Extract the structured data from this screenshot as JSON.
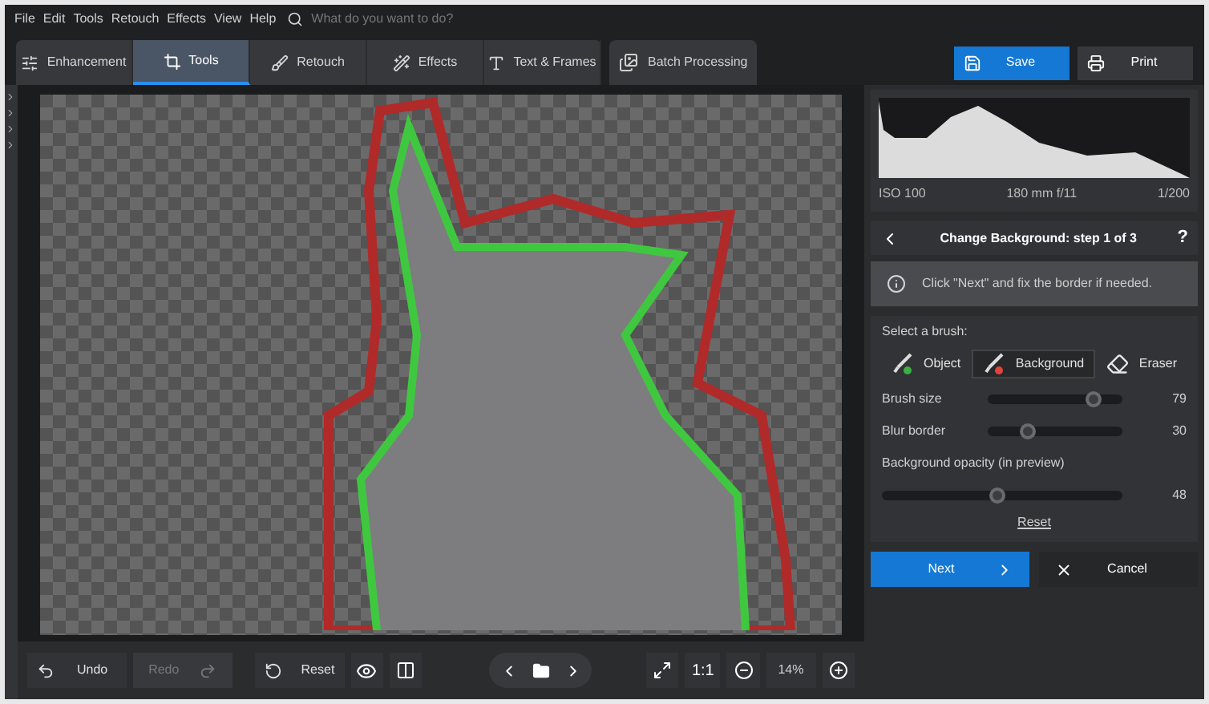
{
  "menu": [
    "File",
    "Edit",
    "Tools",
    "Retouch",
    "Effects",
    "View",
    "Help"
  ],
  "search": {
    "placeholder": "What do you want to do?"
  },
  "tabs": [
    {
      "label": "Enhancement",
      "kind": "sliders",
      "selected": false
    },
    {
      "label": "Tools",
      "kind": "crop",
      "selected": true
    },
    {
      "label": "Retouch",
      "kind": "brush",
      "selected": false
    },
    {
      "label": "Effects",
      "kind": "wand",
      "selected": false
    },
    {
      "label": "Text & Frames",
      "kind": "text",
      "selected": false
    }
  ],
  "batch_button": "Batch Processing",
  "save_button": "Save",
  "print_button": "Print",
  "histogram": {
    "iso": "ISO 100",
    "lens": "180 mm f/11",
    "shutter": "1/200"
  },
  "step": {
    "title": "Change Background: step 1 of 3",
    "help": "?"
  },
  "info": "Click \"Next\" and fix the border if needed.",
  "brush_label": "Select a brush:",
  "brushes": [
    {
      "label": "Object",
      "kind": "object",
      "selected": false
    },
    {
      "label": "Background",
      "kind": "background",
      "selected": true
    },
    {
      "label": "Eraser",
      "kind": "eraser",
      "selected": false
    }
  ],
  "sliders": [
    {
      "label": "Brush size",
      "level": 0.79,
      "reading": "79",
      "kind": "inline"
    },
    {
      "label": "Blur border",
      "level": 0.3,
      "reading": "30",
      "kind": "inline"
    },
    {
      "label": "Background opacity (in preview)",
      "level": 0.48,
      "reading": "48",
      "kind": "stacked"
    }
  ],
  "reset_link": "Reset",
  "next_button": "Next",
  "cancel_button": "Cancel",
  "bottom": {
    "undo": {
      "label": "Undo",
      "disabled": false
    },
    "redo": {
      "label": "Redo",
      "disabled": true
    },
    "reset": "Reset",
    "actual_size": "1:1",
    "zoom": "14%"
  }
}
